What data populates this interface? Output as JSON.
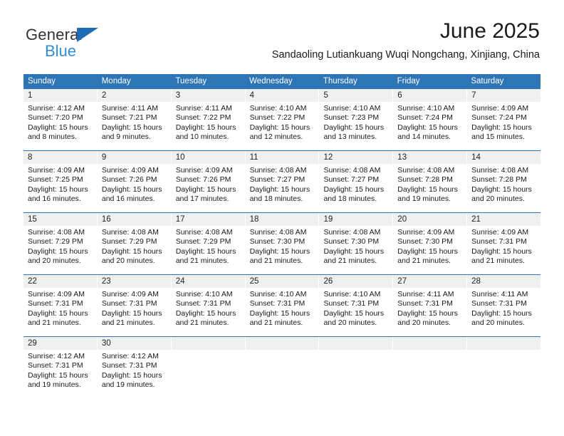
{
  "brand": {
    "name_part1": "General",
    "name_part2": "Blue",
    "accent_color": "#1d6cb5",
    "blue_text_color": "#2f8ed6"
  },
  "header": {
    "month_title": "June 2025",
    "location": "Sandaoling Lutiankuang Wuqi Nongchang, Xinjiang, China"
  },
  "calendar": {
    "header_bg_color": "#2e75b6",
    "day_band_bg_color": "#f0f0f0",
    "weekdays": [
      "Sunday",
      "Monday",
      "Tuesday",
      "Wednesday",
      "Thursday",
      "Friday",
      "Saturday"
    ],
    "weeks": [
      [
        {
          "day": "1",
          "sunrise": "Sunrise: 4:12 AM",
          "sunset": "Sunset: 7:20 PM",
          "daylight_line1": "Daylight: 15 hours",
          "daylight_line2": "and 8 minutes."
        },
        {
          "day": "2",
          "sunrise": "Sunrise: 4:11 AM",
          "sunset": "Sunset: 7:21 PM",
          "daylight_line1": "Daylight: 15 hours",
          "daylight_line2": "and 9 minutes."
        },
        {
          "day": "3",
          "sunrise": "Sunrise: 4:11 AM",
          "sunset": "Sunset: 7:22 PM",
          "daylight_line1": "Daylight: 15 hours",
          "daylight_line2": "and 10 minutes."
        },
        {
          "day": "4",
          "sunrise": "Sunrise: 4:10 AM",
          "sunset": "Sunset: 7:22 PM",
          "daylight_line1": "Daylight: 15 hours",
          "daylight_line2": "and 12 minutes."
        },
        {
          "day": "5",
          "sunrise": "Sunrise: 4:10 AM",
          "sunset": "Sunset: 7:23 PM",
          "daylight_line1": "Daylight: 15 hours",
          "daylight_line2": "and 13 minutes."
        },
        {
          "day": "6",
          "sunrise": "Sunrise: 4:10 AM",
          "sunset": "Sunset: 7:24 PM",
          "daylight_line1": "Daylight: 15 hours",
          "daylight_line2": "and 14 minutes."
        },
        {
          "day": "7",
          "sunrise": "Sunrise: 4:09 AM",
          "sunset": "Sunset: 7:24 PM",
          "daylight_line1": "Daylight: 15 hours",
          "daylight_line2": "and 15 minutes."
        }
      ],
      [
        {
          "day": "8",
          "sunrise": "Sunrise: 4:09 AM",
          "sunset": "Sunset: 7:25 PM",
          "daylight_line1": "Daylight: 15 hours",
          "daylight_line2": "and 16 minutes."
        },
        {
          "day": "9",
          "sunrise": "Sunrise: 4:09 AM",
          "sunset": "Sunset: 7:26 PM",
          "daylight_line1": "Daylight: 15 hours",
          "daylight_line2": "and 16 minutes."
        },
        {
          "day": "10",
          "sunrise": "Sunrise: 4:09 AM",
          "sunset": "Sunset: 7:26 PM",
          "daylight_line1": "Daylight: 15 hours",
          "daylight_line2": "and 17 minutes."
        },
        {
          "day": "11",
          "sunrise": "Sunrise: 4:08 AM",
          "sunset": "Sunset: 7:27 PM",
          "daylight_line1": "Daylight: 15 hours",
          "daylight_line2": "and 18 minutes."
        },
        {
          "day": "12",
          "sunrise": "Sunrise: 4:08 AM",
          "sunset": "Sunset: 7:27 PM",
          "daylight_line1": "Daylight: 15 hours",
          "daylight_line2": "and 18 minutes."
        },
        {
          "day": "13",
          "sunrise": "Sunrise: 4:08 AM",
          "sunset": "Sunset: 7:28 PM",
          "daylight_line1": "Daylight: 15 hours",
          "daylight_line2": "and 19 minutes."
        },
        {
          "day": "14",
          "sunrise": "Sunrise: 4:08 AM",
          "sunset": "Sunset: 7:28 PM",
          "daylight_line1": "Daylight: 15 hours",
          "daylight_line2": "and 20 minutes."
        }
      ],
      [
        {
          "day": "15",
          "sunrise": "Sunrise: 4:08 AM",
          "sunset": "Sunset: 7:29 PM",
          "daylight_line1": "Daylight: 15 hours",
          "daylight_line2": "and 20 minutes."
        },
        {
          "day": "16",
          "sunrise": "Sunrise: 4:08 AM",
          "sunset": "Sunset: 7:29 PM",
          "daylight_line1": "Daylight: 15 hours",
          "daylight_line2": "and 20 minutes."
        },
        {
          "day": "17",
          "sunrise": "Sunrise: 4:08 AM",
          "sunset": "Sunset: 7:29 PM",
          "daylight_line1": "Daylight: 15 hours",
          "daylight_line2": "and 21 minutes."
        },
        {
          "day": "18",
          "sunrise": "Sunrise: 4:08 AM",
          "sunset": "Sunset: 7:30 PM",
          "daylight_line1": "Daylight: 15 hours",
          "daylight_line2": "and 21 minutes."
        },
        {
          "day": "19",
          "sunrise": "Sunrise: 4:08 AM",
          "sunset": "Sunset: 7:30 PM",
          "daylight_line1": "Daylight: 15 hours",
          "daylight_line2": "and 21 minutes."
        },
        {
          "day": "20",
          "sunrise": "Sunrise: 4:09 AM",
          "sunset": "Sunset: 7:30 PM",
          "daylight_line1": "Daylight: 15 hours",
          "daylight_line2": "and 21 minutes."
        },
        {
          "day": "21",
          "sunrise": "Sunrise: 4:09 AM",
          "sunset": "Sunset: 7:31 PM",
          "daylight_line1": "Daylight: 15 hours",
          "daylight_line2": "and 21 minutes."
        }
      ],
      [
        {
          "day": "22",
          "sunrise": "Sunrise: 4:09 AM",
          "sunset": "Sunset: 7:31 PM",
          "daylight_line1": "Daylight: 15 hours",
          "daylight_line2": "and 21 minutes."
        },
        {
          "day": "23",
          "sunrise": "Sunrise: 4:09 AM",
          "sunset": "Sunset: 7:31 PM",
          "daylight_line1": "Daylight: 15 hours",
          "daylight_line2": "and 21 minutes."
        },
        {
          "day": "24",
          "sunrise": "Sunrise: 4:10 AM",
          "sunset": "Sunset: 7:31 PM",
          "daylight_line1": "Daylight: 15 hours",
          "daylight_line2": "and 21 minutes."
        },
        {
          "day": "25",
          "sunrise": "Sunrise: 4:10 AM",
          "sunset": "Sunset: 7:31 PM",
          "daylight_line1": "Daylight: 15 hours",
          "daylight_line2": "and 21 minutes."
        },
        {
          "day": "26",
          "sunrise": "Sunrise: 4:10 AM",
          "sunset": "Sunset: 7:31 PM",
          "daylight_line1": "Daylight: 15 hours",
          "daylight_line2": "and 20 minutes."
        },
        {
          "day": "27",
          "sunrise": "Sunrise: 4:11 AM",
          "sunset": "Sunset: 7:31 PM",
          "daylight_line1": "Daylight: 15 hours",
          "daylight_line2": "and 20 minutes."
        },
        {
          "day": "28",
          "sunrise": "Sunrise: 4:11 AM",
          "sunset": "Sunset: 7:31 PM",
          "daylight_line1": "Daylight: 15 hours",
          "daylight_line2": "and 20 minutes."
        }
      ],
      [
        {
          "day": "29",
          "sunrise": "Sunrise: 4:12 AM",
          "sunset": "Sunset: 7:31 PM",
          "daylight_line1": "Daylight: 15 hours",
          "daylight_line2": "and 19 minutes."
        },
        {
          "day": "30",
          "sunrise": "Sunrise: 4:12 AM",
          "sunset": "Sunset: 7:31 PM",
          "daylight_line1": "Daylight: 15 hours",
          "daylight_line2": "and 19 minutes."
        },
        {
          "day": "",
          "sunrise": "",
          "sunset": "",
          "daylight_line1": "",
          "daylight_line2": ""
        },
        {
          "day": "",
          "sunrise": "",
          "sunset": "",
          "daylight_line1": "",
          "daylight_line2": ""
        },
        {
          "day": "",
          "sunrise": "",
          "sunset": "",
          "daylight_line1": "",
          "daylight_line2": ""
        },
        {
          "day": "",
          "sunrise": "",
          "sunset": "",
          "daylight_line1": "",
          "daylight_line2": ""
        },
        {
          "day": "",
          "sunrise": "",
          "sunset": "",
          "daylight_line1": "",
          "daylight_line2": ""
        }
      ]
    ]
  }
}
